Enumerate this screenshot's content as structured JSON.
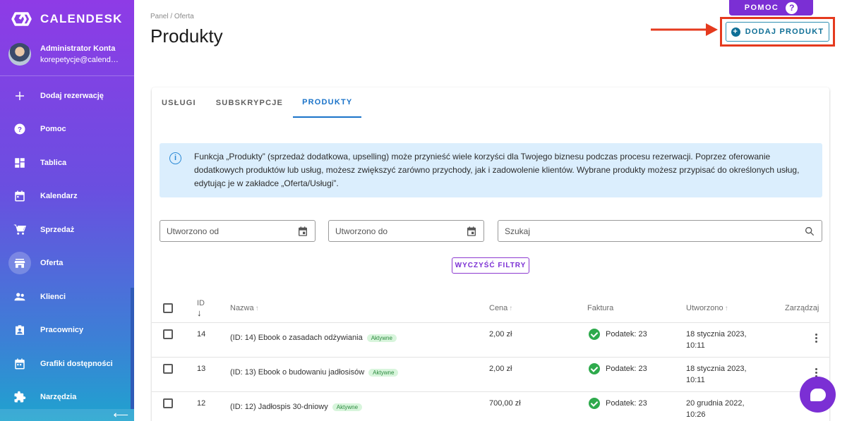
{
  "brand": {
    "name": "CALENDESK"
  },
  "user": {
    "name": "Administrator Konta",
    "email": "korepetycje@calendes..."
  },
  "nav": [
    {
      "label": "Dodaj rezerwację",
      "icon": "plus-icon"
    },
    {
      "label": "Pomoc",
      "icon": "help-icon"
    },
    {
      "label": "Tablica",
      "icon": "dashboard-icon"
    },
    {
      "label": "Kalendarz",
      "icon": "calendar-icon"
    },
    {
      "label": "Sprzedaż",
      "icon": "cart-icon"
    },
    {
      "label": "Oferta",
      "icon": "store-icon",
      "active": true
    },
    {
      "label": "Klienci",
      "icon": "people-icon"
    },
    {
      "label": "Pracownicy",
      "icon": "badge-icon"
    },
    {
      "label": "Grafiki dostępności",
      "icon": "schedule-icon"
    },
    {
      "label": "Narzędzia",
      "icon": "puzzle-icon"
    }
  ],
  "sidebar": {
    "collapse_glyph": "⟵"
  },
  "header": {
    "breadcrumb": "Panel / Oferta",
    "title": "Produkty",
    "help_label": "POMOC",
    "help_glyph": "?",
    "add_label": "DODAJ PRODUKT",
    "add_glyph": "+"
  },
  "tabs": [
    {
      "label": "USŁUGI"
    },
    {
      "label": "SUBSKRYPCJE"
    },
    {
      "label": "PRODUKTY",
      "active": true
    }
  ],
  "info": {
    "glyph": "i",
    "text": "Funkcja „Produkty” (sprzedaż dodatkowa, upselling) może przynieść wiele korzyści dla Twojego biznesu podczas procesu rezerwacji. Poprzez oferowanie dodatkowych produktów lub usług, możesz zwiększyć zarówno przychody, jak i zadowolenie klientów. Wybrane produkty możesz przypisać do określonych usług, edytując je w zakładce „Oferta/Usługi”."
  },
  "filters": {
    "created_from": "Utworzono od",
    "created_to": "Utworzono do",
    "search": "Szukaj",
    "clear_label": "WYCZYŚĆ FILTRY"
  },
  "table": {
    "headers": {
      "id": "ID",
      "id_sort": "↓",
      "name": "Nazwa",
      "price": "Cena",
      "invoice": "Faktura",
      "created": "Utworzono",
      "manage": "Zarządzaj",
      "sort_glyph": "↑"
    },
    "rows": [
      {
        "id": "14",
        "name": "(ID: 14) Ebook o zasadach odżywiania",
        "status": "Aktywne",
        "price": "2,00 zł",
        "tax": "Podatek: 23",
        "date": "18 stycznia 2023,",
        "time": "10:11"
      },
      {
        "id": "13",
        "name": "(ID: 13) Ebook o budowaniu jadłosisów",
        "status": "Aktywne",
        "price": "2,00 zł",
        "tax": "Podatek: 23",
        "date": "18 stycznia 2023,",
        "time": "10:11"
      },
      {
        "id": "12",
        "name": "(ID: 12) Jadłospis 30-dniowy",
        "status": "Aktywne",
        "price": "700,00 zł",
        "tax": "Podatek: 23",
        "date": "20 grudnia 2022,",
        "time": "10:26"
      }
    ]
  },
  "colors": {
    "accent": "#7b2fd4",
    "tab_active": "#1a73c9",
    "annotation": "#e53a1e",
    "success": "#2eaa4c"
  }
}
